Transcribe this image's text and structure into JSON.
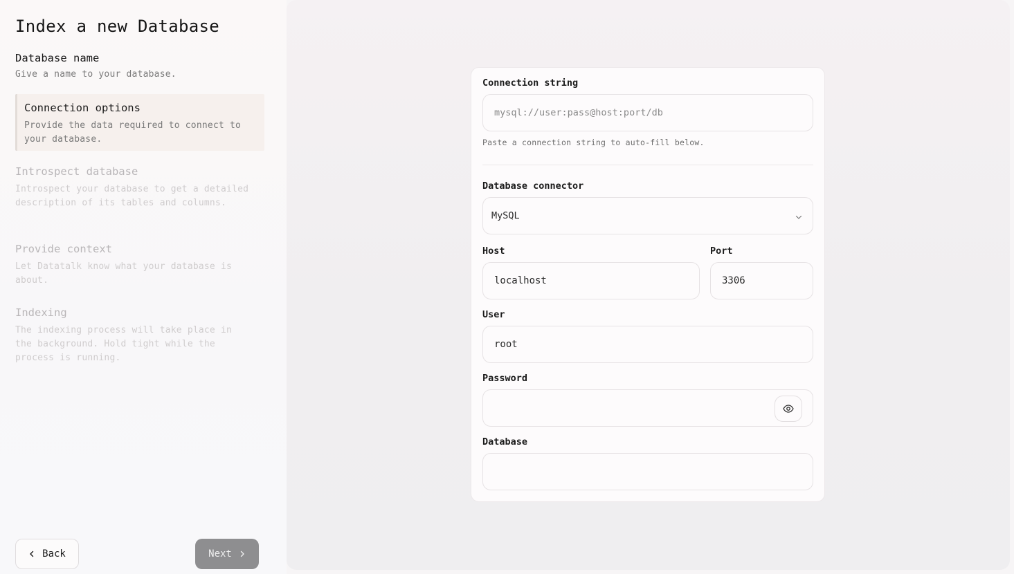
{
  "page_title": "Index a new Database",
  "steps": [
    {
      "title": "Database name",
      "desc": "Give a name to your database."
    },
    {
      "title": "Connection options",
      "desc": "Provide the data required to connect to your database."
    },
    {
      "title": "Introspect database",
      "desc": "Introspect your database to get a detailed description of its tables and columns."
    },
    {
      "title": "Provide context",
      "desc": "Let Datatalk know what your database is about."
    },
    {
      "title": "Indexing",
      "desc": "The indexing process will take place in the background. Hold tight while the process is running."
    }
  ],
  "nav": {
    "back_label": "Back",
    "next_label": "Next"
  },
  "form": {
    "connection_string": {
      "label": "Connection string",
      "placeholder": "mysql://user:pass@host:port/db",
      "hint": "Paste a connection string to auto-fill below."
    },
    "connector": {
      "label": "Database connector",
      "value": "MySQL"
    },
    "host": {
      "label": "Host",
      "value": "localhost"
    },
    "port": {
      "label": "Port",
      "value": "3306"
    },
    "user": {
      "label": "User",
      "value": "root"
    },
    "password": {
      "label": "Password",
      "value": ""
    },
    "database": {
      "label": "Database",
      "value": ""
    }
  },
  "icons": {
    "back": "chevron-left-icon",
    "next": "chevron-right-icon",
    "select": "chevron-down-icon",
    "password_toggle": "eye-icon"
  }
}
